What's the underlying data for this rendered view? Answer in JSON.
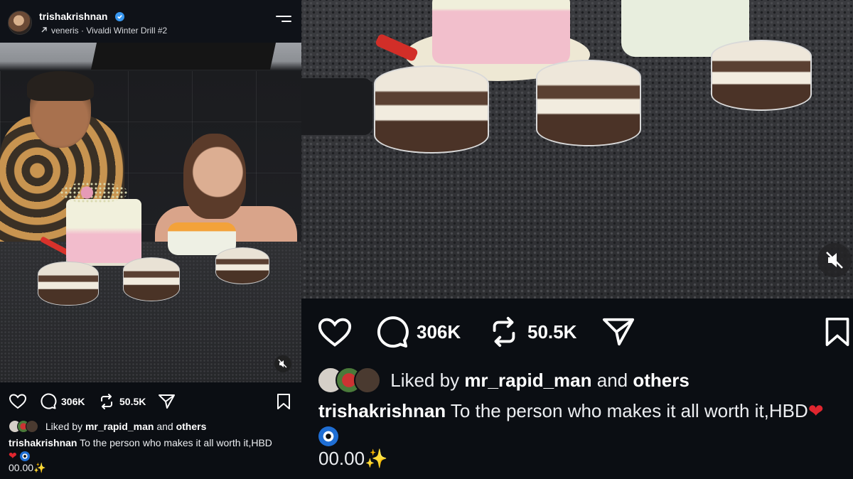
{
  "post": {
    "username": "trishakrishnan",
    "audio_label": "veneris · Vivaldi Winter Drill #2",
    "comments_count": "306K",
    "reposts_count": "50.5K",
    "liked_by_prefix": "Liked by",
    "liked_by_user": "mr_rapid_man",
    "liked_by_and": "and",
    "liked_by_others": "others",
    "caption_user": "trishakrishnan",
    "caption_text": " To the person who makes it all worth it,HBD",
    "caption_time": "00.00"
  },
  "icons": {
    "verified": "verified-badge-icon",
    "audio_arrow": "arrow-up-right-icon",
    "menu": "menu-icon",
    "like": "heart-icon",
    "comment": "comment-icon",
    "repost": "repost-icon",
    "share": "send-icon",
    "save": "bookmark-icon",
    "mute": "muted-speaker-icon"
  },
  "colors": {
    "background": "#0b0e13",
    "verified": "#3897f0",
    "text": "#f4f5f7"
  }
}
